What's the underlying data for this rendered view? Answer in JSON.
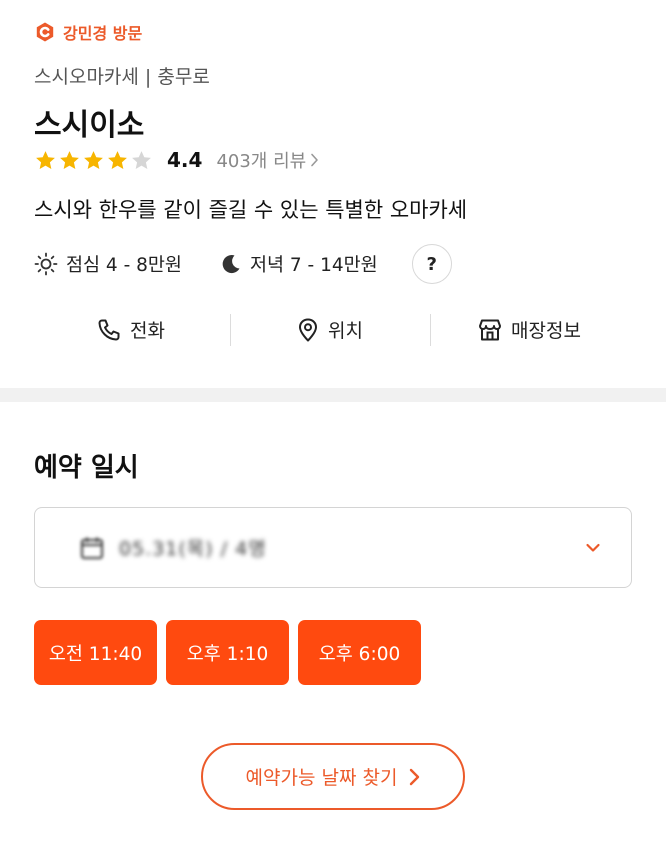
{
  "visit_badge": {
    "label": "강민경 방문",
    "icon": "catchtable-logo-icon"
  },
  "restaurant": {
    "category": "스시오마카세 | 충무로",
    "name": "스시이소",
    "rating": 4.4,
    "rating_text": "4.4",
    "stars_filled": 4,
    "stars_total": 5,
    "review_count": "403개 리뷰",
    "description": "스시와 한우를 같이 즐길 수 있는 특별한 오마카세"
  },
  "price": {
    "lunch": "점심 4 - 8만원",
    "dinner": "저녁 7 - 14만원",
    "help": "?"
  },
  "actions": [
    {
      "label": "전화",
      "icon": "phone-icon"
    },
    {
      "label": "위치",
      "icon": "location-pin-icon"
    },
    {
      "label": "매장정보",
      "icon": "store-icon"
    }
  ],
  "reservation": {
    "title": "예약 일시",
    "selected_date": "05.31(목) / 4명",
    "time_slots": [
      "오전 11:40",
      "오후 1:10",
      "오후 6:00"
    ],
    "find_button": "예약가능 날짜 찾기"
  },
  "colors": {
    "accent": "#ff4a0f",
    "accent_text": "#ec5a2a",
    "star": "#f7b500",
    "star_empty": "#d6d6d6"
  }
}
